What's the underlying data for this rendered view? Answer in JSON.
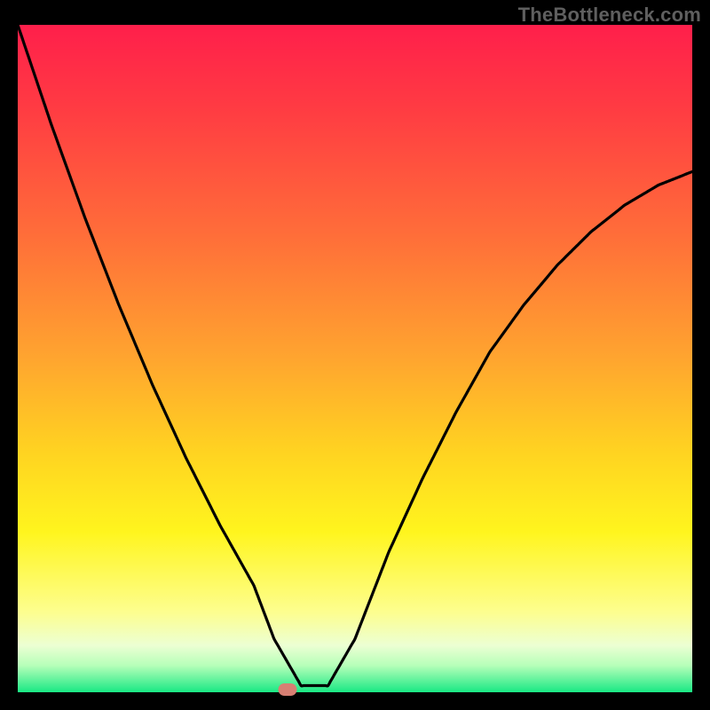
{
  "watermark": "TheBottleneck.com",
  "chart_data": {
    "type": "line",
    "title": "",
    "xlabel": "",
    "ylabel": "",
    "xlim": [
      0,
      100
    ],
    "ylim": [
      0,
      100
    ],
    "grid": false,
    "legend": false,
    "series": [
      {
        "name": "bottleneck-curve",
        "x": [
          0,
          5,
          10,
          15,
          20,
          25,
          30,
          35,
          38,
          42,
          46,
          50,
          55,
          60,
          65,
          70,
          75,
          80,
          85,
          90,
          95,
          100
        ],
        "values": [
          100,
          85,
          71,
          58,
          46,
          35,
          25,
          16,
          8,
          1,
          1,
          8,
          21,
          32,
          42,
          51,
          58,
          64,
          69,
          73,
          76,
          78
        ]
      }
    ],
    "marker": {
      "x": 40,
      "y": 0,
      "color": "#d77f73"
    },
    "background_gradient": {
      "stops": [
        {
          "pos": 0,
          "color": "#ff1f4b"
        },
        {
          "pos": 12,
          "color": "#ff3a43"
        },
        {
          "pos": 32,
          "color": "#ff6f39"
        },
        {
          "pos": 50,
          "color": "#ffa52f"
        },
        {
          "pos": 64,
          "color": "#ffd321"
        },
        {
          "pos": 76,
          "color": "#fff51e"
        },
        {
          "pos": 88,
          "color": "#fdfe8f"
        },
        {
          "pos": 93,
          "color": "#ecffd3"
        },
        {
          "pos": 96,
          "color": "#b6ffb9"
        },
        {
          "pos": 100,
          "color": "#19e884"
        }
      ]
    }
  }
}
